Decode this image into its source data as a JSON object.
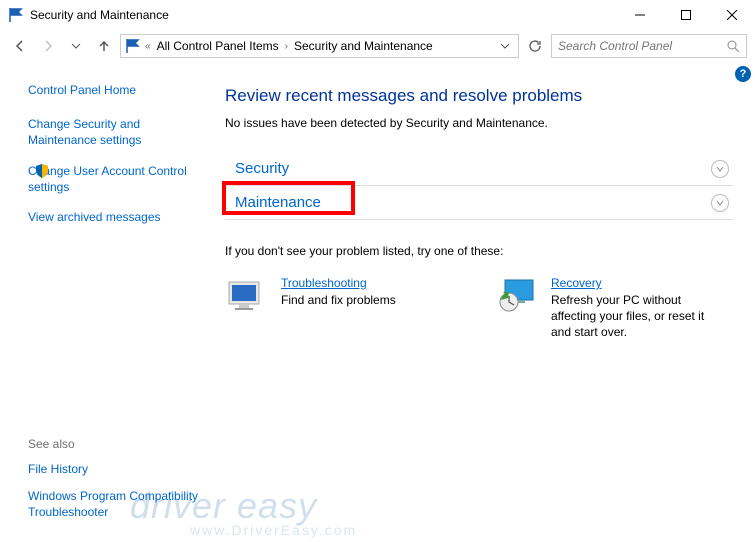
{
  "window": {
    "title": "Security and Maintenance"
  },
  "breadcrumbs": {
    "overflow": "«",
    "item1": "All Control Panel Items",
    "item2": "Security and Maintenance"
  },
  "search": {
    "placeholder": "Search Control Panel"
  },
  "sidebar": {
    "home": "Control Panel Home",
    "link1": "Change Security and Maintenance settings",
    "link2": "Change User Account Control settings",
    "link3": "View archived messages"
  },
  "seealso": {
    "header": "See also",
    "link1": "File History",
    "link2": "Windows Program Compatibility Troubleshooter"
  },
  "main": {
    "heading": "Review recent messages and resolve problems",
    "status": "No issues have been detected by Security and Maintenance.",
    "section_security": "Security",
    "section_maintenance": "Maintenance",
    "try_text": "If you don't see your problem listed, try one of these:",
    "troubleshooting": {
      "title": "Troubleshooting",
      "desc": "Find and fix problems"
    },
    "recovery": {
      "title": "Recovery",
      "desc": "Refresh your PC without affecting your files, or reset it and start over."
    }
  },
  "help": "?",
  "watermark": {
    "main": "driver easy",
    "sub": "www.DriverEasy.com"
  }
}
